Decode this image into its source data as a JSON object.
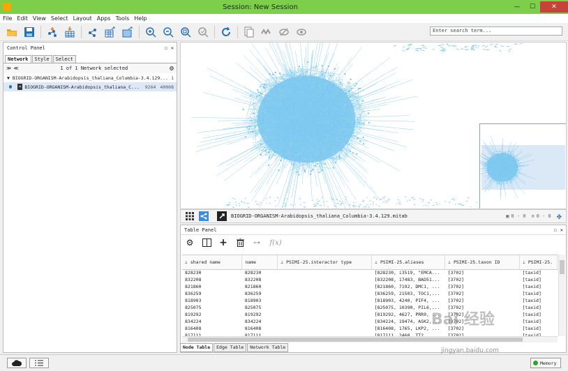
{
  "window": {
    "title": "Session: New Session",
    "minimize": "—",
    "maximize": "☐",
    "close": "✕"
  },
  "menu": [
    "File",
    "Edit",
    "View",
    "Select",
    "Layout",
    "Apps",
    "Tools",
    "Help"
  ],
  "search": {
    "placeholder": "Enter search term..."
  },
  "control_panel": {
    "title": "Control Panel",
    "tabs": [
      "Network",
      "Style",
      "Select"
    ],
    "selection_status": "1 of 1 Network selected",
    "collection": "BIOGRID-ORGANISM-Arabidopsis_thaliana_Columbia-3.4.129...",
    "collection_count": "1",
    "network": {
      "name": "BIOGRID-ORGANISM-Arabidopsis_thaliana_C...",
      "nodes": "9264",
      "edges": "40008"
    }
  },
  "network_view": {
    "node_color": "#7ac7ee",
    "label": "BIOGRID-ORGANISM-Arabidopsis_thaliana_Columbia-3.4.129.mitab",
    "sel_nodes": "0 - 0",
    "sel_edges": "0 - 0"
  },
  "table_panel": {
    "title": "Table Panel",
    "columns": [
      "shared name",
      "name",
      "PSIMI-25.interactor type",
      "PSIMI-25.aliases",
      "PSIMI-25.taxon ID",
      "PSIMI-25."
    ],
    "rows": [
      [
        "828230",
        "828230",
        "",
        "[828230, i3519, \"EMCA...",
        "[3702]",
        "[taxid]"
      ],
      [
        "832208",
        "832208",
        "",
        "[832208, 17483, BAD51...",
        "[3702]",
        "[taxid]"
      ],
      [
        "821860",
        "821860",
        "",
        "[821860, 7192, DMC1, ...",
        "[3702]",
        "[taxid]"
      ],
      [
        "836259",
        "836259",
        "",
        "[836259, 21503, TOC1,...",
        "[3702]",
        "[taxid]"
      ],
      [
        "818903",
        "818903",
        "",
        "[818903, 4240, PIF4, ...",
        "[3702]",
        "[taxid]"
      ],
      [
        "825075",
        "825075",
        "",
        "[825075, 10390, PIL6,...",
        "[3702]",
        "[taxid]"
      ],
      [
        "819292",
        "819292",
        "",
        "[819292, 4627, PRR9, ...",
        "[3702]",
        "[taxid]"
      ],
      [
        "834224",
        "834224",
        "",
        "[834224, 19474, ASK2,...",
        "[3702]",
        "[taxid]"
      ],
      [
        "816408",
        "816408",
        "",
        "[816408, 1765, LKP2, ...",
        "[3702]",
        "[taxid]"
      ],
      [
        "817111",
        "817111",
        "",
        "[817111, 2460, TT2, ...",
        "[3702]",
        "[taxid]"
      ]
    ],
    "bottom_tabs": [
      "Node Table",
      "Edge Table",
      "Network Table"
    ]
  },
  "status": {
    "memory": "Memory"
  },
  "watermark": {
    "main": "Bai 经验",
    "sub": "jingyan.baidu.com"
  }
}
